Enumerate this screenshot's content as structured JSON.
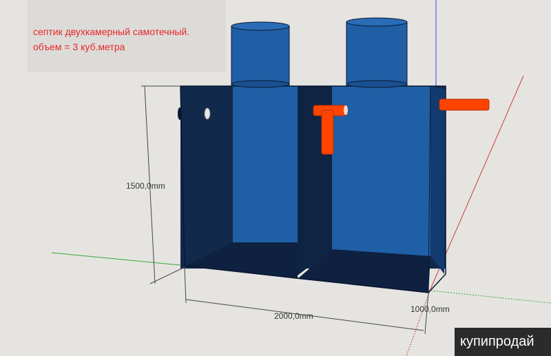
{
  "caption": {
    "line1": "септик двухкамерный самотечный.",
    "line2": "объем = 3 куб.метра"
  },
  "dimensions": {
    "height": "1500,0mm",
    "length": "2000,0mm",
    "depth": "1000,0mm"
  },
  "watermark": "купипродай",
  "colors": {
    "tank_dark": "#11294b",
    "tank_blue": "#1f5fa6",
    "pipe_orange": "#ff4400",
    "caption_red": "#e8262a",
    "axis_green": "#3aa43a",
    "axis_red": "#d23a3a",
    "axis_blue": "#3a3aff"
  }
}
